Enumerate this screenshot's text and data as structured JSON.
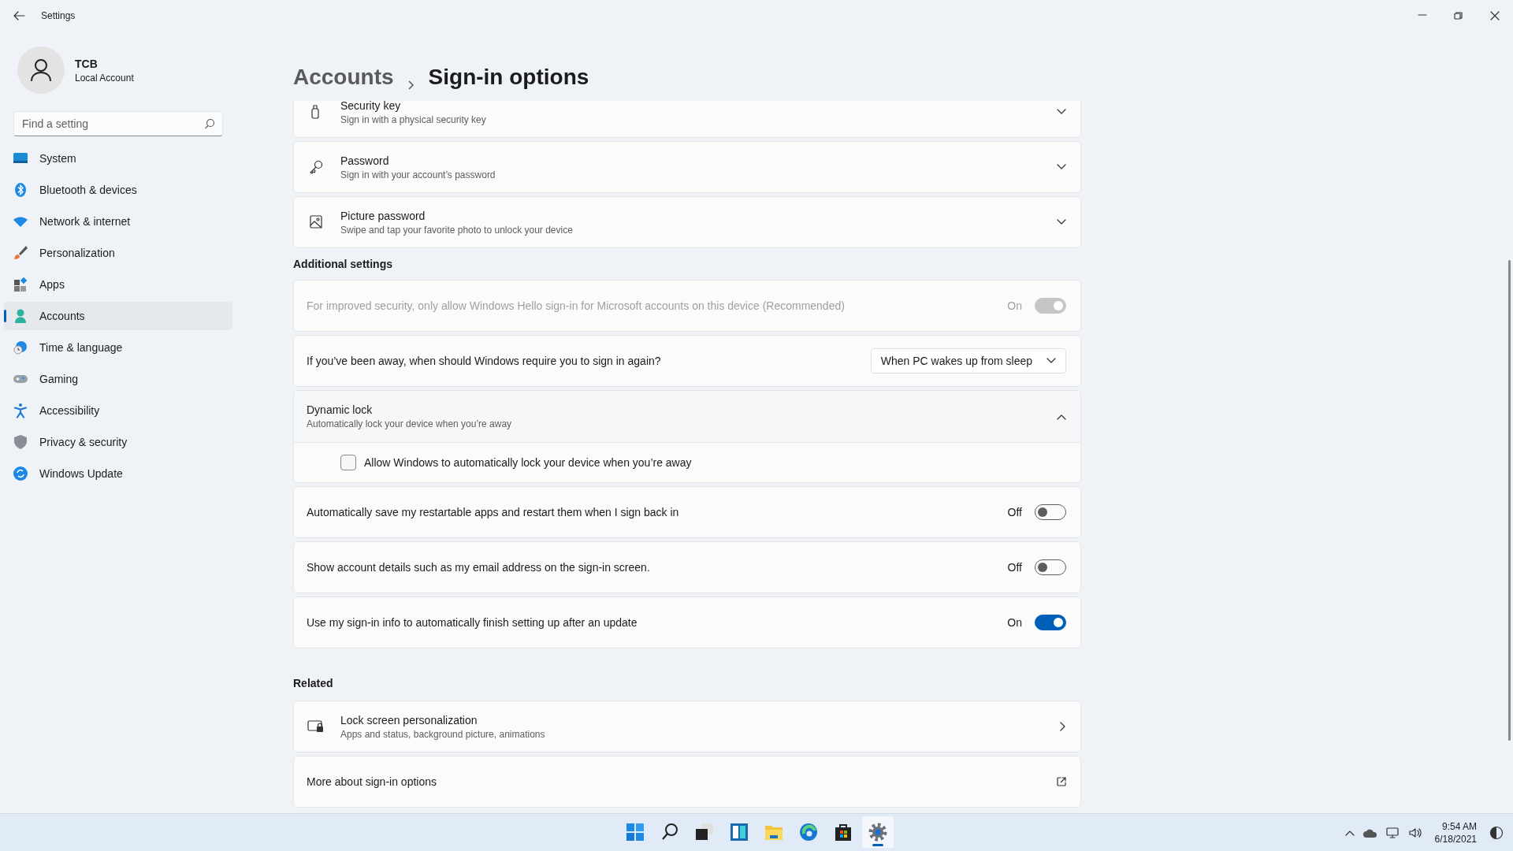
{
  "window": {
    "title": "Settings"
  },
  "profile": {
    "name": "TCB",
    "account_type": "Local Account"
  },
  "search": {
    "placeholder": "Find a setting"
  },
  "sidebar": {
    "items": [
      {
        "label": "System",
        "selected": false
      },
      {
        "label": "Bluetooth & devices",
        "selected": false
      },
      {
        "label": "Network & internet",
        "selected": false
      },
      {
        "label": "Personalization",
        "selected": false
      },
      {
        "label": "Apps",
        "selected": false
      },
      {
        "label": "Accounts",
        "selected": true
      },
      {
        "label": "Time & language",
        "selected": false
      },
      {
        "label": "Gaming",
        "selected": false
      },
      {
        "label": "Accessibility",
        "selected": false
      },
      {
        "label": "Privacy & security",
        "selected": false
      },
      {
        "label": "Windows Update",
        "selected": false
      }
    ]
  },
  "breadcrumb": {
    "parent": "Accounts",
    "current": "Sign-in options"
  },
  "sign_in_methods": [
    {
      "title": "Security key",
      "subtitle": "Sign in with a physical security key",
      "expanded": false
    },
    {
      "title": "Password",
      "subtitle": "Sign in with your account’s password",
      "expanded": false
    },
    {
      "title": "Picture password",
      "subtitle": "Swipe and tap your favorite photo to unlock your device",
      "expanded": false
    }
  ],
  "additional_settings": {
    "heading": "Additional settings",
    "items": [
      {
        "kind": "toggle",
        "label": "For improved security, only allow Windows Hello sign-in for Microsoft accounts on this device (Recommended)",
        "state_text": "On",
        "on": true,
        "disabled": true
      },
      {
        "kind": "dropdown",
        "label": "If you’ve been away, when should Windows require you to sign in again?",
        "value": "When PC wakes up from sleep"
      },
      {
        "kind": "expander",
        "title": "Dynamic lock",
        "subtitle": "Automatically lock your device when you’re away",
        "expanded": true,
        "children": [
          {
            "kind": "checkbox",
            "label": "Allow Windows to automatically lock your device when you’re away",
            "checked": false
          }
        ]
      },
      {
        "kind": "toggle",
        "label": "Automatically save my restartable apps and restart them when I sign back in",
        "state_text": "Off",
        "on": false,
        "disabled": false
      },
      {
        "kind": "toggle",
        "label": "Show account details such as my email address on the sign-in screen.",
        "state_text": "Off",
        "on": false,
        "disabled": false
      },
      {
        "kind": "toggle",
        "label": "Use my sign-in info to automatically finish setting up after an update",
        "state_text": "On",
        "on": true,
        "disabled": false
      }
    ]
  },
  "related": {
    "heading": "Related",
    "items": [
      {
        "kind": "link",
        "title": "Lock screen personalization",
        "subtitle": "Apps and status, background picture, animations"
      },
      {
        "kind": "external",
        "title": "More about sign-in options"
      }
    ]
  },
  "taskbar": {
    "apps": [
      {
        "selected": false
      },
      {
        "selected": false
      },
      {
        "selected": false
      },
      {
        "selected": false
      },
      {
        "selected": false
      },
      {
        "selected": false
      },
      {
        "selected": false
      },
      {
        "selected": true
      }
    ],
    "time": "9:54 AM",
    "date": "6/18/2021"
  }
}
